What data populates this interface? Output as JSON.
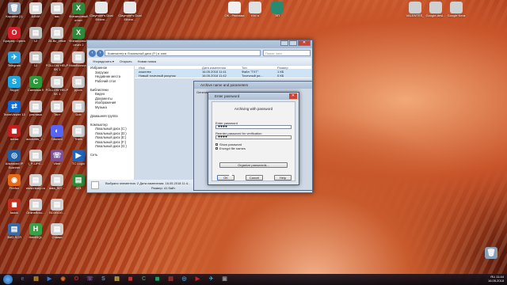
{
  "desktop_icons": [
    {
      "label": "Корзина (1)",
      "col": 0,
      "row": 0,
      "color": "#8aa0b5",
      "glyph": "🗑"
    },
    {
      "label": "Браузер Opera",
      "col": 0,
      "row": 1,
      "color": "#d0202a",
      "glyph": "O"
    },
    {
      "label": "Telegram",
      "col": 0,
      "row": 2,
      "color": "#2aa3dd",
      "glyph": "✈"
    },
    {
      "label": "Skype",
      "col": 0,
      "row": 3,
      "color": "#1ea8e0",
      "glyph": "S"
    },
    {
      "label": "TeamViewer 13",
      "col": 0,
      "row": 4,
      "color": "#0e6bd3",
      "glyph": "⇄"
    },
    {
      "label": "зсеаа",
      "col": 0,
      "row": 5,
      "color": "#c02020",
      "glyph": "◼"
    },
    {
      "label": "Advanced IP Scanner",
      "col": 0,
      "row": 6,
      "color": "#1d5faa",
      "glyph": "◎"
    },
    {
      "label": "Firefox",
      "col": 0,
      "row": 7,
      "color": "#e66a14",
      "glyph": "◉"
    },
    {
      "label": "taskki",
      "col": 0,
      "row": 8,
      "color": "#c03020",
      "glyph": "◼"
    },
    {
      "label": "3MG.SCR",
      "col": 0,
      "row": 9,
      "color": "#3a6aa0",
      "glyph": "▤"
    },
    {
      "label": "Δ4МИ",
      "col": 1,
      "row": 0,
      "color": "#d8d8d8",
      "glyph": "▤"
    },
    {
      "label": "12",
      "col": 1,
      "row": 1,
      "color": "#c0c0c0",
      "glyph": "▤"
    },
    {
      "label": "12",
      "col": 1,
      "row": 2,
      "color": "#c0c0c0",
      "glyph": "▤"
    },
    {
      "label": "Camtasia 9",
      "col": 1,
      "row": 3,
      "color": "#2d9a3a",
      "glyph": "C"
    },
    {
      "label": "реклама",
      "col": 1,
      "row": 4,
      "color": "#d0d0d0",
      "glyph": "▤"
    },
    {
      "label": "accounts_7...",
      "col": 1,
      "row": 5,
      "color": "#d0d0d0",
      "glyph": "▤"
    },
    {
      "label": "I_P-IJPE...",
      "col": 1,
      "row": 6,
      "color": "#d0d0d0",
      "glyph": "▤"
    },
    {
      "label": "www.nkarp.ru",
      "col": 1,
      "row": 7,
      "color": "#d0d0d0",
      "glyph": "▤"
    },
    {
      "label": "OnlineBroo...",
      "col": 1,
      "row": 8,
      "color": "#d0d0d0",
      "glyph": "▤"
    },
    {
      "label": "HeidiSQL",
      "col": 1,
      "row": 9,
      "color": "#3aa048",
      "glyph": "H"
    },
    {
      "label": "вас",
      "col": 2,
      "row": 0,
      "color": "#d0d0d0",
      "glyph": "▤"
    },
    {
      "label": "28-Вс_office",
      "col": 2,
      "row": 1,
      "color": "#d0d0d0",
      "glyph": "▤"
    },
    {
      "label": "FOLLOW HELP SK 1",
      "col": 2,
      "row": 2,
      "color": "#d0d0d0",
      "glyph": "▤"
    },
    {
      "label": "FOLLOW HELP SK 1",
      "col": 2,
      "row": 3,
      "color": "#d0d0d0",
      "glyph": "▤"
    },
    {
      "label": "Тест",
      "col": 2,
      "row": 4,
      "color": "#d0d0d0",
      "glyph": "▤"
    },
    {
      "label": "Discord",
      "col": 2,
      "row": 5,
      "color": "#5865f2",
      "glyph": "◐"
    },
    {
      "label": "Viber",
      "col": 2,
      "row": 6,
      "color": "#7b519d",
      "glyph": "☏"
    },
    {
      "label": "data_507...",
      "col": 2,
      "row": 7,
      "color": "#d0d0d0",
      "glyph": "▤"
    },
    {
      "label": "ВОЗВОЛ...",
      "col": 2,
      "row": 8,
      "color": "#d0d0d0",
      "glyph": "▤"
    },
    {
      "label": "Ставки",
      "col": 2,
      "row": 9,
      "color": "#d0d0d0",
      "glyph": "▤"
    },
    {
      "label": "Финансовый отчет",
      "col": 3,
      "row": 0,
      "color": "#2e8a3a",
      "glyph": "X"
    },
    {
      "label": "Финансовый отчет 2",
      "col": 3,
      "row": 1,
      "color": "#2e8a3a",
      "glyph": "X"
    },
    {
      "label": "MobiBrowser",
      "col": 3,
      "row": 2,
      "color": "#d0d0d0",
      "glyph": "▤"
    },
    {
      "label": "ppom",
      "col": 3,
      "row": 3,
      "color": "#d0d0d0",
      "glyph": "▤"
    },
    {
      "label": "Dolt",
      "col": 3,
      "row": 4,
      "color": "#d0d0d0",
      "glyph": "▤"
    },
    {
      "label": "Trans",
      "col": 3,
      "row": 5,
      "color": "#d0d0d0",
      "glyph": "▤"
    },
    {
      "label": "TC Login",
      "col": 3,
      "row": 6,
      "color": "#1d66c0",
      "glyph": "▶"
    },
    {
      "label": "423",
      "col": 3,
      "row": 7,
      "color": "#2e8a3a",
      "glyph": "▤"
    }
  ],
  "top_icons": [
    {
      "label": "Claymore's Dual Ethere...",
      "color": "#e8e8e8"
    },
    {
      "label": "Claymore's Dual Ethere...",
      "color": "#e8e8e8"
    },
    {
      "label": "ОК - Реклама",
      "color": "#f0f0f0"
    },
    {
      "label": "Кто я",
      "color": "#e0e0e0"
    },
    {
      "label": "ЭП",
      "color": "#2a8a70"
    },
    {
      "label": "VALENTES_",
      "color": "#d0d0d0"
    },
    {
      "label": "Google-desi...",
      "color": "#d0d0d0"
    },
    {
      "label": "Google Клик",
      "color": "#d0d0d0"
    }
  ],
  "explorer": {
    "title": "",
    "address": "Компьютер ▸ Локальный диск (F:) ▸ zam",
    "search": "Поиск: zam",
    "toolbar": [
      "Упорядочить ▾",
      "Открыть",
      "Новая папка"
    ],
    "nav": [
      "Избранное",
      "Загрузки",
      "Недавние места",
      "Рабочий стол",
      "",
      "Библиотеки",
      "Видео",
      "Документы",
      "Изображения",
      "Музыка",
      "",
      "Домашняя группа",
      "",
      "Компьютер",
      "Локальный диск (C:)",
      "Локальный диск (D:)",
      "Локальный диск (E:)",
      "Локальный диск (F:)",
      "Локальный диск (G:)",
      "",
      "Сеть"
    ],
    "columns": [
      "Имя",
      "Дата изменения",
      "Тип",
      "Размер"
    ],
    "rows": [
      [
        "кошелек",
        "16.05.2018 11:41",
        "Файл \"TXT\"",
        "1 КБ"
      ],
      [
        "Новый точечный рисунок",
        "16.05.2018 11:42",
        "Точечный ри...",
        "0 КБ"
      ]
    ],
    "status": "Выбрано элементов: 2  Дата изменения: 16.05.2018 11:4...",
    "status2": "Размер: 41 байт"
  },
  "archive_dialog": {
    "title": "Archive name and parameters",
    "tab": "General"
  },
  "password_dialog": {
    "title": "Enter password",
    "heading": "Archiving with password",
    "enter_label": "Enter password",
    "enter_value": "●●●●",
    "reenter_label": "Reenter password for verification",
    "reenter_value": "●●●●",
    "show_password": "Show password",
    "encrypt_names": "Encrypt file names",
    "organize": "Organize passwords...",
    "ok": "OK",
    "cancel": "Cancel",
    "help": "Help"
  },
  "taskbar": {
    "apps": [
      {
        "g": "e",
        "c": "#1f6fd0"
      },
      {
        "g": "▤",
        "c": "#e0a020"
      },
      {
        "g": "▶",
        "c": "#2a7ad0"
      },
      {
        "g": "◉",
        "c": "#e06a14"
      },
      {
        "g": "O",
        "c": "#d0202a"
      },
      {
        "g": "☏",
        "c": "#7b519d"
      },
      {
        "g": "S",
        "c": "#1ea8e0"
      },
      {
        "g": "▤",
        "c": "#e0c040"
      },
      {
        "g": "◼",
        "c": "#c03030"
      },
      {
        "g": "C",
        "c": "#2d9a3a"
      },
      {
        "g": "◼",
        "c": "#1ca060"
      },
      {
        "g": "▤",
        "c": "#c03030"
      },
      {
        "g": "◎",
        "c": "#2aa3dd"
      },
      {
        "g": "▶",
        "c": "#d02020"
      },
      {
        "g": "✈",
        "c": "#2aa3dd"
      },
      {
        "g": "▣",
        "c": "#909090"
      }
    ],
    "time": "11:44",
    "date": "16.05.2018",
    "lang": "RU"
  }
}
